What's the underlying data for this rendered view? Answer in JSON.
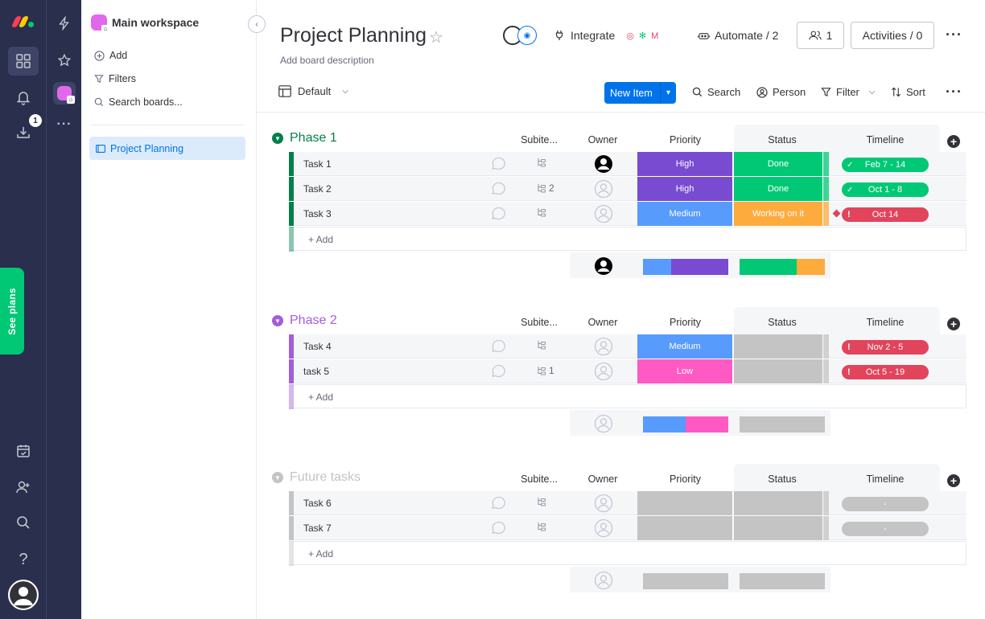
{
  "rail": {
    "notifications_badge": "1",
    "see_plans": "See plans"
  },
  "workspace": {
    "name": "Main workspace",
    "collapse_glyph": "‹",
    "actions": [
      {
        "label": "Add",
        "icon": "plus-circle-icon"
      },
      {
        "label": "Filters",
        "icon": "filter-icon"
      },
      {
        "label": "Search boards...",
        "icon": "search-icon"
      }
    ],
    "boards": [
      {
        "label": "Project Planning",
        "active": true
      }
    ]
  },
  "header": {
    "title": "Project Planning",
    "description": "Add board description",
    "integrate": "Integrate",
    "automate": "Automate / 2",
    "members": "1",
    "activities": "Activities / 0",
    "more": "···"
  },
  "toolbar": {
    "view": "Default",
    "new_item": "New Item",
    "search": "Search",
    "person": "Person",
    "filter": "Filter",
    "sort": "Sort",
    "more": "···"
  },
  "columns": {
    "subitems": "Subite...",
    "owner": "Owner",
    "priority": "Priority",
    "status": "Status",
    "timeline": "Timeline"
  },
  "add_label": "+ Add",
  "colors": {
    "green": "#00c875",
    "purple": "#a25ddc",
    "grey": "#c4c4c4",
    "high": "#784bd1",
    "medium": "#579bfc",
    "low": "#ff5ac4",
    "working": "#fdab3d",
    "stuck": "#e2445c",
    "blue": "#0073ea"
  },
  "groups": [
    {
      "title": "Phase 1",
      "color": "#037f4c",
      "stripe": "#037f4c",
      "items": [
        {
          "name": "Task 1",
          "subitems": "",
          "owner": "filled",
          "priority": "High",
          "status": "Done",
          "timeline": "Feb 7 - 14",
          "timeline_state": "done"
        },
        {
          "name": "Task 2",
          "subitems": "2",
          "owner": "empty",
          "priority": "High",
          "status": "Done",
          "timeline": "Oct 1 - 8",
          "timeline_state": "done"
        },
        {
          "name": "Task 3",
          "subitems": "",
          "owner": "empty",
          "priority": "Medium",
          "status": "Working on it",
          "timeline": "Oct 14",
          "timeline_state": "overdue"
        }
      ],
      "summary": {
        "priority": [
          {
            "label": "Medium",
            "share": 0.33
          },
          {
            "label": "High",
            "share": 0.67
          }
        ],
        "status": [
          {
            "label": "Done",
            "share": 0.67
          },
          {
            "label": "Working on it",
            "share": 0.33
          }
        ]
      }
    },
    {
      "title": "Phase 2",
      "color": "#a25ddc",
      "stripe": "#a25ddc",
      "items": [
        {
          "name": "Task 4",
          "subitems": "",
          "owner": "empty",
          "priority": "Medium",
          "status": "",
          "timeline": "Nov 2 - 5",
          "timeline_state": "overdue"
        },
        {
          "name": "task 5",
          "subitems": "1",
          "owner": "empty",
          "priority": "Low",
          "status": "",
          "timeline": "Oct 5 - 19",
          "timeline_state": "overdue"
        }
      ],
      "summary": {
        "priority": [
          {
            "label": "Medium",
            "share": 0.5
          },
          {
            "label": "Low",
            "share": 0.5
          }
        ],
        "status": [
          {
            "label": "",
            "share": 1
          }
        ]
      }
    },
    {
      "title": "Future tasks",
      "color": "#c4c4c4",
      "stripe": "#c4c4c4",
      "items": [
        {
          "name": "Task 6",
          "subitems": "",
          "owner": "empty",
          "priority": "",
          "status": "",
          "timeline": "-",
          "timeline_state": "empty"
        },
        {
          "name": "Task 7",
          "subitems": "",
          "owner": "empty",
          "priority": "",
          "status": "",
          "timeline": "-",
          "timeline_state": "empty"
        }
      ],
      "summary": {
        "priority": [
          {
            "label": "",
            "share": 1
          }
        ],
        "status": [
          {
            "label": "",
            "share": 1
          }
        ]
      }
    }
  ]
}
